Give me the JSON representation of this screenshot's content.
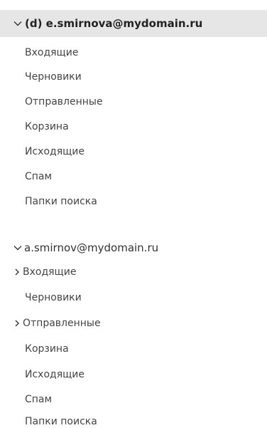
{
  "accounts": [
    {
      "name": "(d) e.smirnova@mydomain.ru",
      "expanded": true,
      "selected": true,
      "folders": [
        {
          "label": "Входящие",
          "has_children": false
        },
        {
          "label": "Черновики",
          "has_children": false
        },
        {
          "label": "Отправленные",
          "has_children": false
        },
        {
          "label": "Корзина",
          "has_children": false
        },
        {
          "label": "Исходящие",
          "has_children": false
        },
        {
          "label": "Спам",
          "has_children": false
        },
        {
          "label": "Папки поиска",
          "has_children": false
        }
      ]
    },
    {
      "name": "a.smirnov@mydomain.ru",
      "expanded": true,
      "selected": false,
      "folders": [
        {
          "label": "Входящие",
          "has_children": true
        },
        {
          "label": "Черновики",
          "has_children": false
        },
        {
          "label": "Отправленные",
          "has_children": true
        },
        {
          "label": "Корзина",
          "has_children": false
        },
        {
          "label": "Исходящие",
          "has_children": false
        },
        {
          "label": "Спам",
          "has_children": false
        },
        {
          "label": "Папки поиска",
          "has_children": false
        }
      ]
    }
  ],
  "icons": {
    "expand": "chevron-down-icon",
    "collapsed": "chevron-right-icon"
  },
  "colors": {
    "selected_background": "#e6e6e6",
    "text": "#444444"
  }
}
